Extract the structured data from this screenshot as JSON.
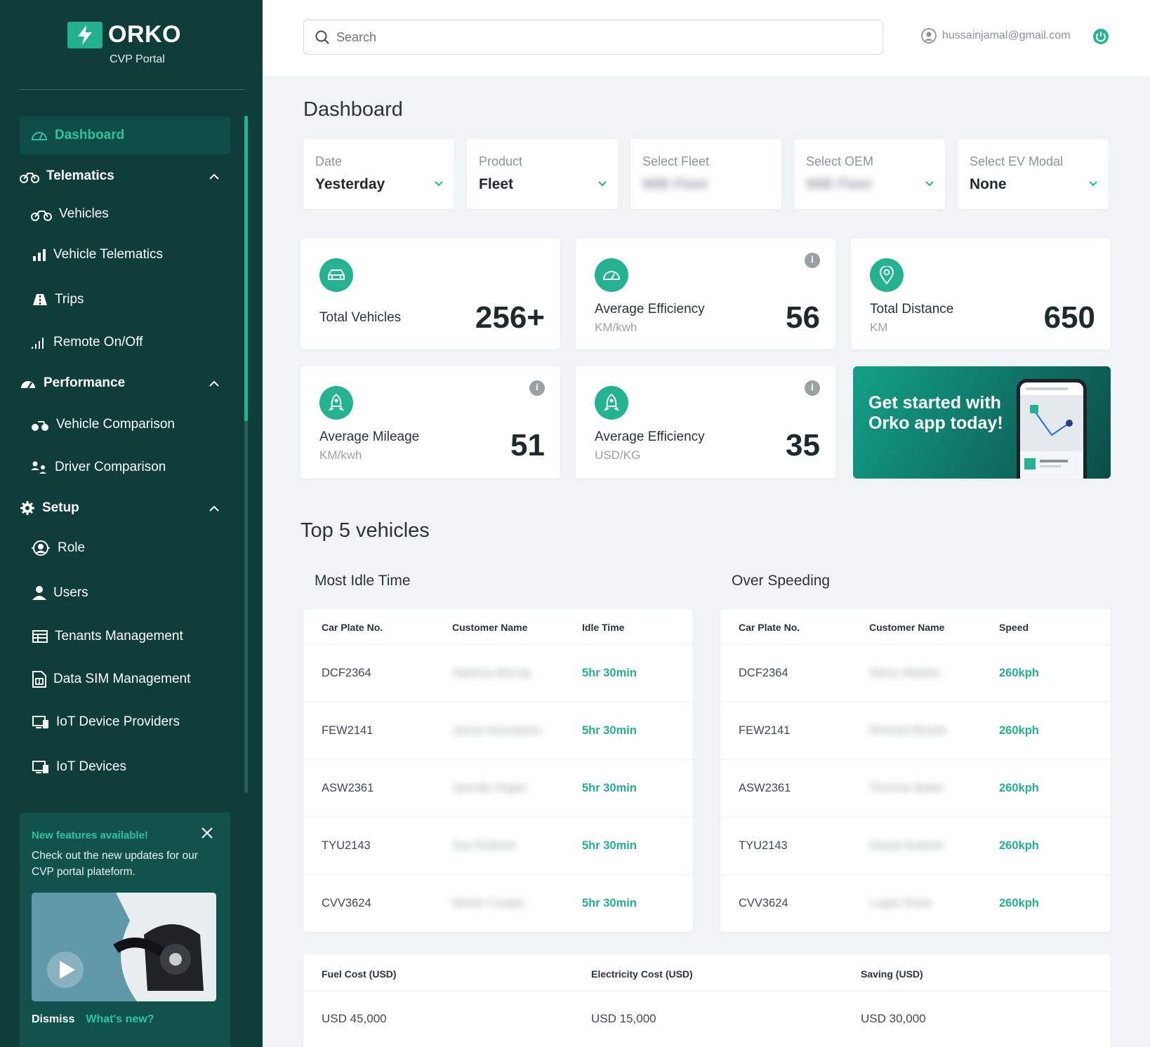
{
  "brand": {
    "name": "ORKO",
    "subtitle": "CVP Portal"
  },
  "sidebar": {
    "active": "Dashboard",
    "sections": {
      "telematics": "Telematics",
      "performance": "Performance",
      "setup": "Setup"
    },
    "items": {
      "vehicles": "Vehicles",
      "vehicle_telematics": "Vehicle Telematics",
      "trips": "Trips",
      "remote": "Remote On/Off",
      "vehicle_comparison": "Vehicle Comparison",
      "driver_comparison": "Driver Comparison",
      "role": "Role",
      "users": "Users",
      "tenants": "Tenants Management",
      "data_sim": "Data SIM Management",
      "iot_providers": "IoT Device Providers",
      "iot_devices": "IoT Devices"
    },
    "promo": {
      "title": "New features available!",
      "text": "Check out the new updates for our CVP portal plateform.",
      "dismiss": "Dismiss",
      "whats_new": "What's new?"
    }
  },
  "topbar": {
    "search_placeholder": "Search",
    "email": "hussainjamal@gmail.com"
  },
  "page_title": "Dashboard",
  "filters": [
    {
      "label": "Date",
      "value": "Yesterday"
    },
    {
      "label": "Product",
      "value": "Fleet"
    },
    {
      "label": "Select Fleet",
      "value": "MIB Fleet"
    },
    {
      "label": "Select OEM",
      "value": "MIB Fleet"
    },
    {
      "label": "Select EV Modal",
      "value": "None"
    }
  ],
  "stats": {
    "total_vehicles": {
      "label": "Total Vehicles",
      "value": "256+"
    },
    "avg_efficiency_kwh": {
      "label": "Average Efficiency",
      "unit": "KM/kwh",
      "value": "56"
    },
    "total_distance": {
      "label": "Total Distance",
      "unit": "KM",
      "value": "650"
    },
    "avg_mileage": {
      "label": "Average Mileage",
      "unit": "KM/kwh",
      "value": "51"
    },
    "avg_efficiency_usd": {
      "label": "Average Efficiency",
      "unit": "USD/KG",
      "value": "35"
    }
  },
  "app_banner": {
    "text": "Get started with Orko app today!"
  },
  "top_vehicles": {
    "title": "Top 5 vehicles",
    "idle": {
      "title": "Most Idle Time",
      "headers": [
        "Car Plate No.",
        "Customer Name",
        "Idle Time"
      ],
      "rows": [
        [
          "DCF2364",
          "Sabrina Murray",
          "5hr 30min"
        ],
        [
          "FEW2141",
          "Jamal Hussainee",
          "5hr 30min"
        ],
        [
          "ASW2361",
          "Jennifer Rajan",
          "5hr 30min"
        ],
        [
          "TYU2143",
          "Sue Roberts",
          "5hr 30min"
        ],
        [
          "CVV3624",
          "Martin Cooper",
          "5hr 30min"
        ]
      ]
    },
    "speed": {
      "title": "Over Speeding",
      "headers": [
        "Car Plate No.",
        "Customer Name",
        "Speed"
      ],
      "rows": [
        [
          "DCF2364",
          "Steve Martins",
          "260kph"
        ],
        [
          "FEW2141",
          "Richard Breath",
          "260kph"
        ],
        [
          "ASW2361",
          "Thomas Baker",
          "260kph"
        ],
        [
          "TYU2143",
          "Daniel Andrew",
          "260kph"
        ],
        [
          "CVV3624",
          "Logan Rose",
          "260kph"
        ]
      ]
    }
  },
  "costs": {
    "headers": [
      "Fuel Cost (USD)",
      "Electricity Cost (USD)",
      "Saving (USD)"
    ],
    "values": [
      "USD 45,000",
      "USD 15,000",
      "USD 30,000"
    ]
  },
  "colors": {
    "sidebar": "#0f3d3a",
    "accent": "#23b391",
    "background": "#f1f4f5"
  }
}
